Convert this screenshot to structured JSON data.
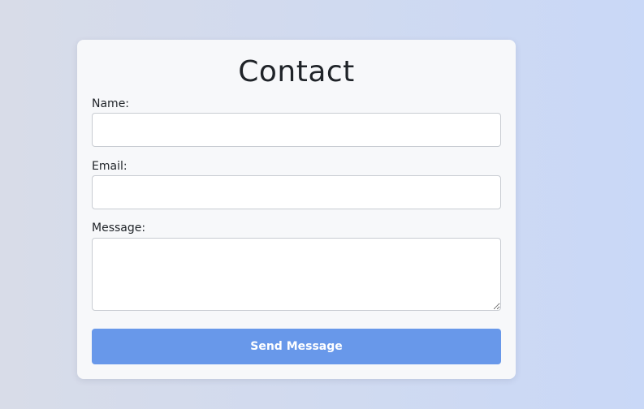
{
  "form": {
    "title": "Contact",
    "name_label": "Name:",
    "name_value": "",
    "email_label": "Email:",
    "email_value": "",
    "message_label": "Message:",
    "message_value": "",
    "submit_label": "Send Message"
  },
  "colors": {
    "accent": "#6898ea",
    "card_background": "#f7f8fa"
  }
}
